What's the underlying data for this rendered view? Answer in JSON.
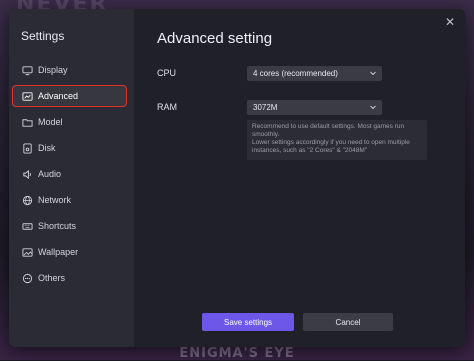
{
  "background": {
    "top_text": "NEVER",
    "bottom_text": "ENIGMA'S EYE"
  },
  "sidebar": {
    "title": "Settings",
    "items": [
      {
        "label": "Display",
        "icon": "monitor-icon"
      },
      {
        "label": "Advanced",
        "icon": "advanced-icon",
        "active": true
      },
      {
        "label": "Model",
        "icon": "folder-icon"
      },
      {
        "label": "Disk",
        "icon": "disk-icon"
      },
      {
        "label": "Audio",
        "icon": "audio-icon"
      },
      {
        "label": "Network",
        "icon": "globe-icon"
      },
      {
        "label": "Shortcuts",
        "icon": "keyboard-icon"
      },
      {
        "label": "Wallpaper",
        "icon": "wallpaper-icon"
      },
      {
        "label": "Others",
        "icon": "others-icon"
      }
    ]
  },
  "main": {
    "title": "Advanced setting",
    "cpu": {
      "label": "CPU",
      "value": "4 cores (recommended)"
    },
    "ram": {
      "label": "RAM",
      "value": "3072M"
    },
    "hint": "Recommend to use default settings. Most games run smoothly.\nLower settings accordingly if you need to open multiple instances, such as \"2 Cores\" & \"2048M\"",
    "save_label": "Save settings",
    "cancel_label": "Cancel",
    "close_glyph": "✕"
  },
  "colors": {
    "accent": "#6c57e8",
    "highlight_outline": "#e0342a",
    "sidebar_bg": "#2a2b34",
    "panel_bg": "#1f2028"
  }
}
